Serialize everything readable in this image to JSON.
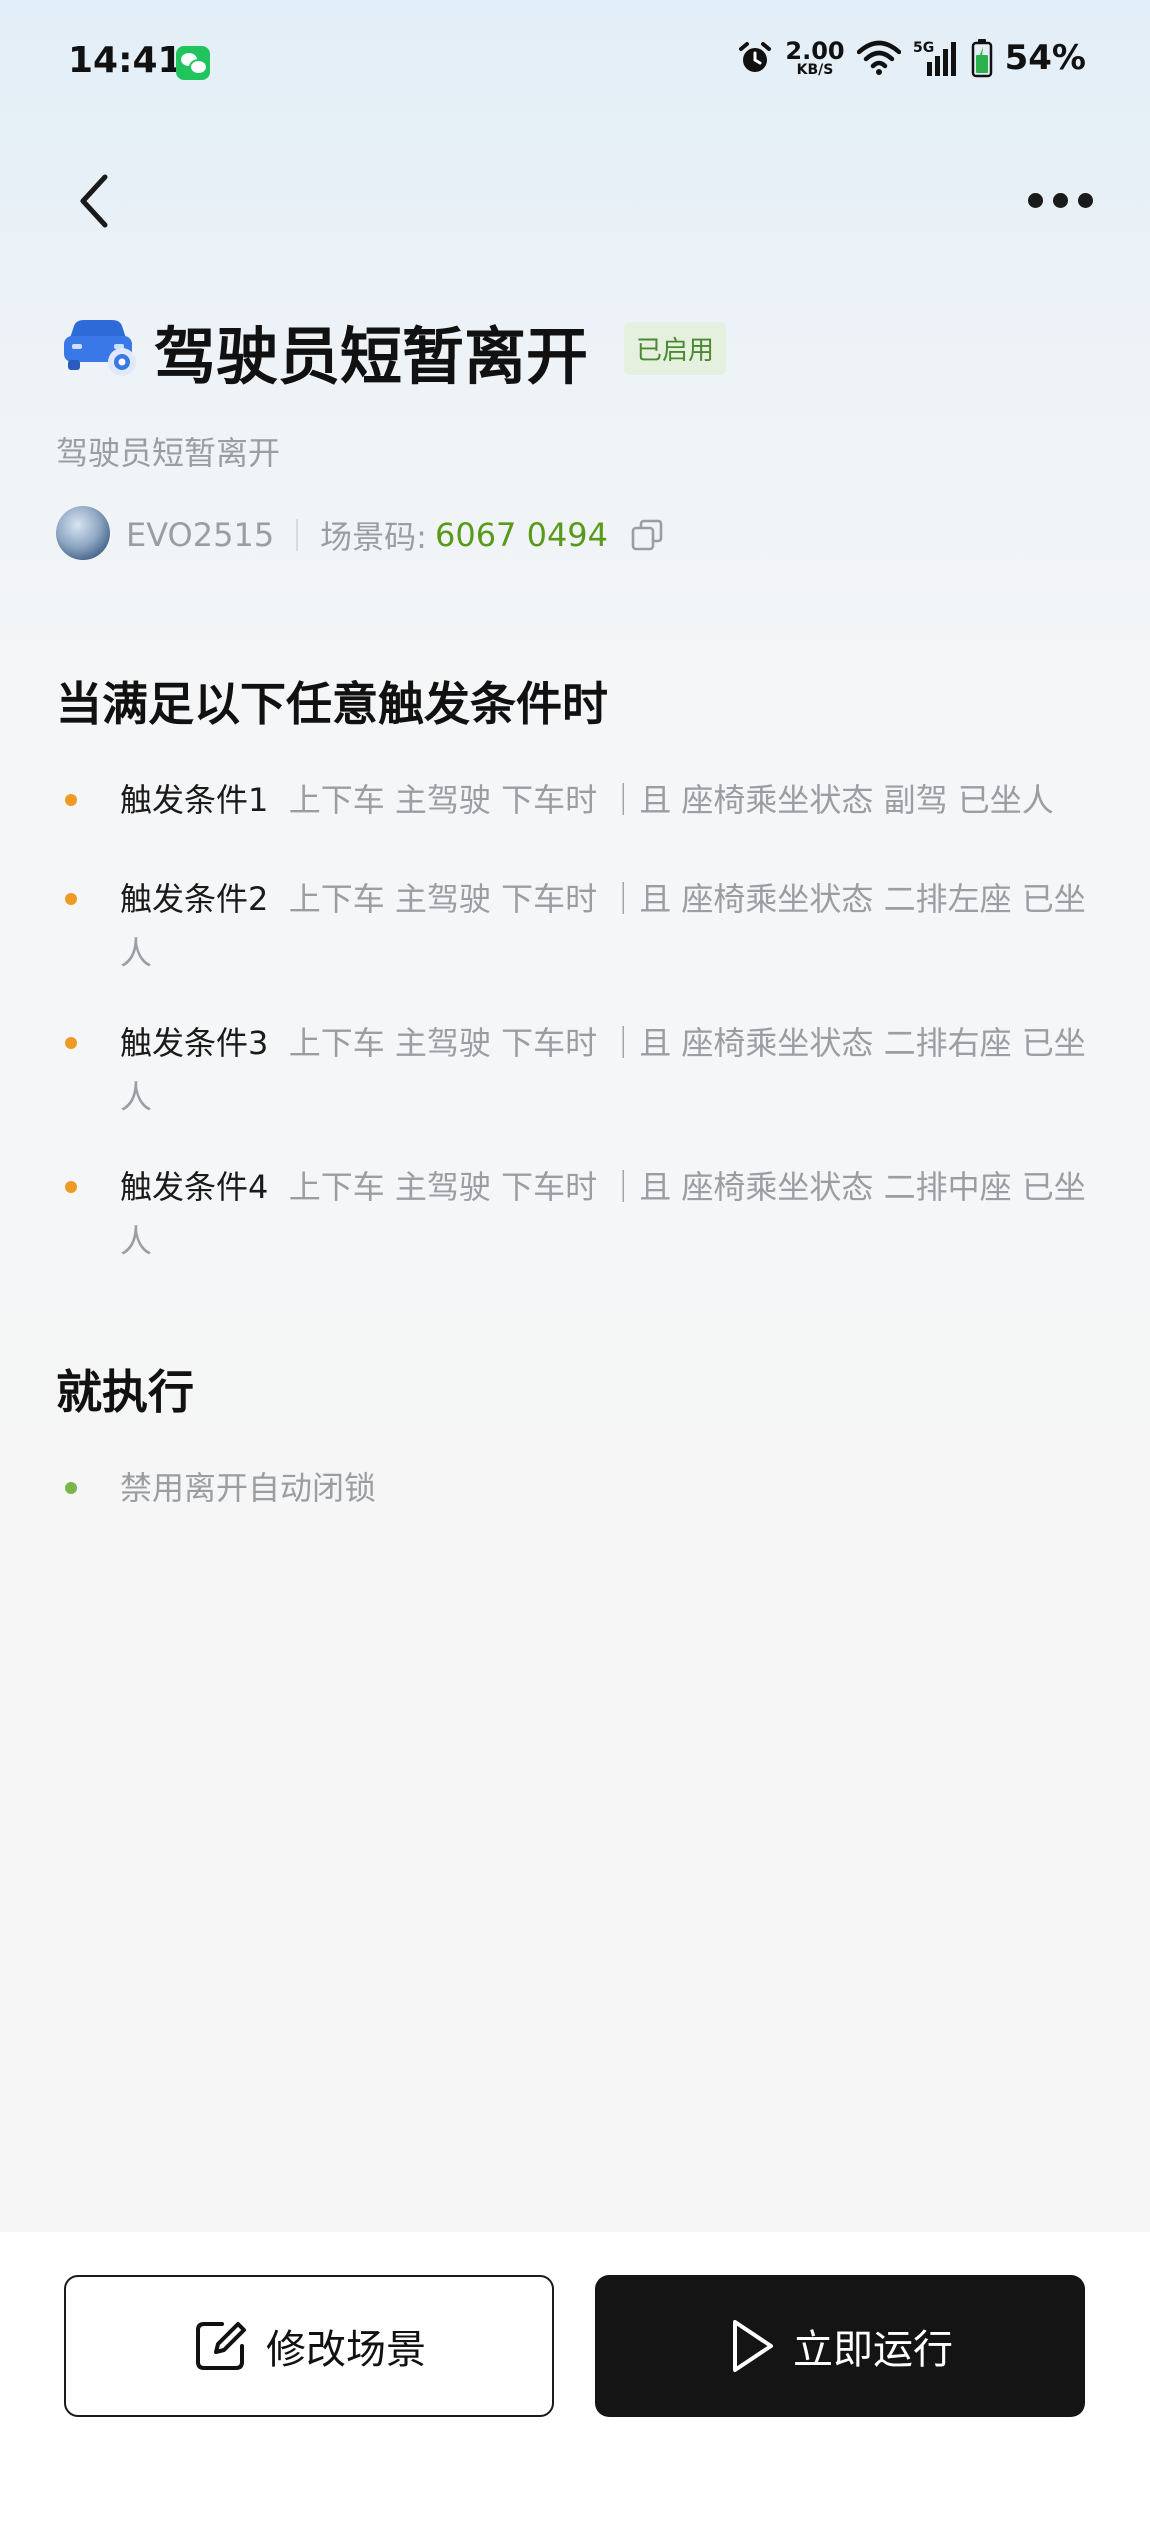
{
  "status_bar": {
    "time": "14:41",
    "speed_value": "2.00",
    "speed_unit": "KB/S",
    "network": "5G",
    "battery": "54%",
    "icons": [
      "wechat-icon",
      "alarm-icon",
      "wifi-icon",
      "signal-icon",
      "battery-icon"
    ]
  },
  "header": {
    "back_icon": "chevron-left-icon",
    "more_icon": "more-dots-icon"
  },
  "scene": {
    "icon": "car-icon",
    "title": "驾驶员短暂离开",
    "status": "已启用",
    "description": "驾驶员短暂离开",
    "owner": "EVO2515",
    "code_label": "场景码:",
    "code_value": "6067 0494"
  },
  "conditions": {
    "heading": "当满足以下任意触发条件时",
    "items": [
      {
        "name": "触发条件1",
        "detail": "上下车 主驾驶 下车时 ｜且 座椅乘坐状态 副驾 已坐人"
      },
      {
        "name": "触发条件2",
        "detail": "上下车 主驾驶 下车时 ｜且 座椅乘坐状态 二排左座 已坐人"
      },
      {
        "name": "触发条件3",
        "detail": "上下车 主驾驶 下车时 ｜且 座椅乘坐状态 二排右座 已坐人"
      },
      {
        "name": "触发条件4",
        "detail": "上下车 主驾驶 下车时 ｜且 座椅乘坐状态 二排中座 已坐人"
      }
    ]
  },
  "actions": {
    "heading": "就执行",
    "items": [
      "禁用离开自动闭锁"
    ]
  },
  "buttons": {
    "edit_label": "修改场景",
    "run_label": "立即运行"
  },
  "colors": {
    "accent_green": "#5a9a1a",
    "bullet_orange": "#ef9a22",
    "bullet_green": "#7bb54a",
    "run_button": "#141414"
  }
}
